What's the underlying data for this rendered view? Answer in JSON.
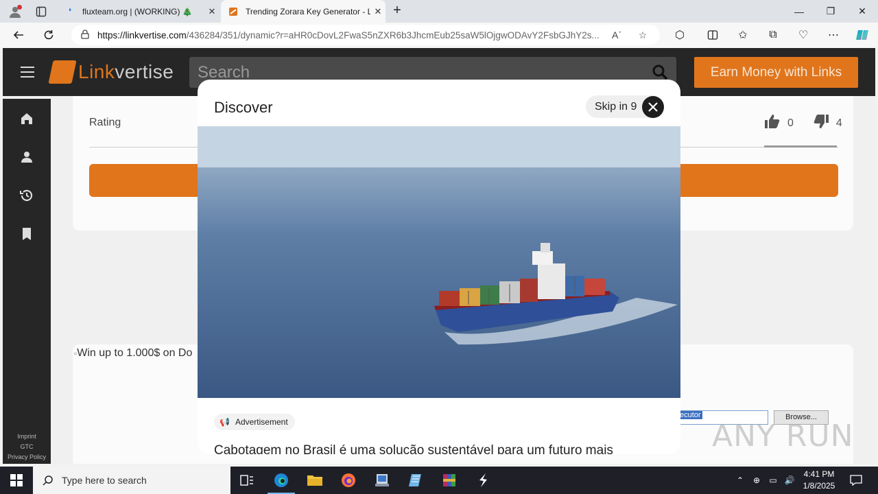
{
  "browser": {
    "tabs": [
      {
        "title": "fluxteam.org | (WORKING) 🎄",
        "active": false
      },
      {
        "title": "Trending Zorara Key Generator - L",
        "active": true
      }
    ],
    "url_host": "https://linkvertise.com",
    "url_rest": "/436284/351/dynamic?r=aHR0cDovL2FwaS5nZXR6b3JhcmEub25saW5lOjgwODAvY2FsbGJhY2s..."
  },
  "site": {
    "brand": "Linkvertise",
    "brand_prefix": "Link",
    "brand_suffix": "vertise",
    "search_placeholder": "Search",
    "earn_button": "Earn Money with Links",
    "sidebar_footer": [
      "Imprint",
      "GTC",
      "Privacy Policy"
    ],
    "accent_color": "#e0751c"
  },
  "content": {
    "rating_label": "Rating",
    "likes": "0",
    "dislikes": "4",
    "broken_image_alt": "Win up to 1.000$ on Do",
    "file_input_value": "ecutor",
    "browse_button": "Browse..."
  },
  "modal": {
    "title": "Discover",
    "skip_text": "Skip in 9",
    "ad_label": "Advertisement",
    "headline": "Cabotagem no Brasil é uma solução sustentável para um futuro mais"
  },
  "watermark": "ANY RUN",
  "taskbar": {
    "search_placeholder": "Type here to search",
    "time": "4:41 PM",
    "date": "1/8/2025"
  }
}
